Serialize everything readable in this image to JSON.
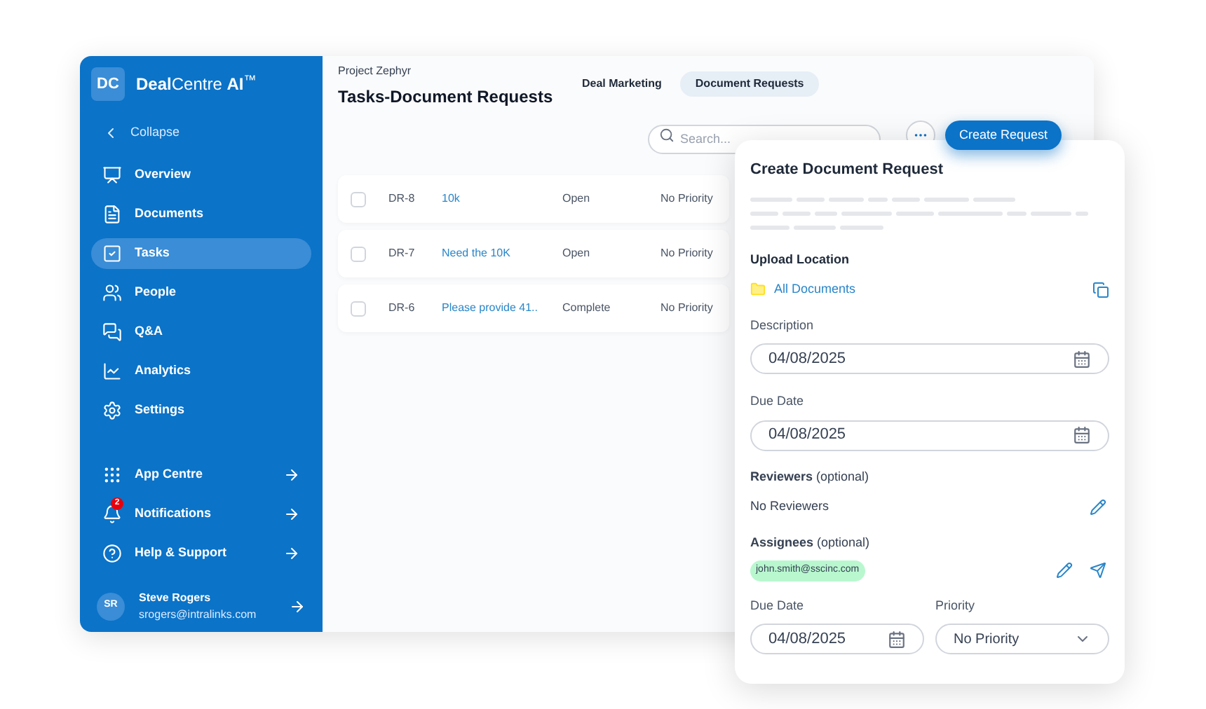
{
  "sidebar": {
    "logo": "DC",
    "brand": "**Deal**Centre **AI**$^{™}$",
    "collapse": "Collapse",
    "nav": [
      {
        "kind": "overview",
        "label": "Overview",
        "selected": false
      },
      {
        "kind": "documents",
        "label": "Documents",
        "selected": false
      },
      {
        "kind": "tasks",
        "label": "Tasks",
        "selected": true
      },
      {
        "kind": "people",
        "label": "People",
        "selected": false
      },
      {
        "kind": "qa",
        "label": "Q&A",
        "selected": false
      },
      {
        "kind": "analytics",
        "label": "Analytics",
        "selected": false
      },
      {
        "kind": "settings",
        "label": "Settings",
        "selected": false
      }
    ],
    "links": [
      {
        "kind": "apps",
        "label": "App Centre"
      },
      {
        "kind": "notifications",
        "label": "Notifications",
        "badge": "2"
      },
      {
        "kind": "help",
        "label": "Help & Support"
      }
    ],
    "user": {
      "initials": "SR",
      "name": "Steve Rogers",
      "email": "srogers@intralinks.com"
    }
  },
  "header": {
    "project": "Project Zephyr",
    "title": "Tasks-Document Requests",
    "tabs": [
      {
        "label": "Deal Marketing",
        "selected": false
      },
      {
        "label": "Document Requests",
        "selected": true
      }
    ]
  },
  "toolbar": {
    "search": {
      "placeholder": "Search..."
    },
    "create_button": "Create Request"
  },
  "rows": [
    {
      "checked": false,
      "id": "DR-8",
      "title": "10k",
      "status": "Open",
      "priority": "No Priority"
    },
    {
      "checked": false,
      "id": "DR-7",
      "title": "Need the 10K",
      "status": "Open",
      "priority": "No Priority"
    },
    {
      "checked": false,
      "id": "DR-6",
      "title": "Please provide 41..",
      "status": "Complete",
      "priority": "No Priority"
    }
  ],
  "dialog": {
    "title": "Create Document Request",
    "upload_label": "Upload Location",
    "upload_folder": "All Documents",
    "description_label": "Description",
    "description_value": "04/08/2025",
    "due_label": "Due Date",
    "due_value": "04/08/2025",
    "reviewers_label": "**Reviewers** (optional)",
    "reviewers_value": "No Reviewers",
    "assignees_label": "**Assignees** (optional)",
    "assignees": [
      "john.smith@sscinc.com"
    ],
    "due2_label": "Due Date",
    "due2_value": "04/08/2025",
    "priority_label": "Priority",
    "priority_value": "No Priority"
  }
}
